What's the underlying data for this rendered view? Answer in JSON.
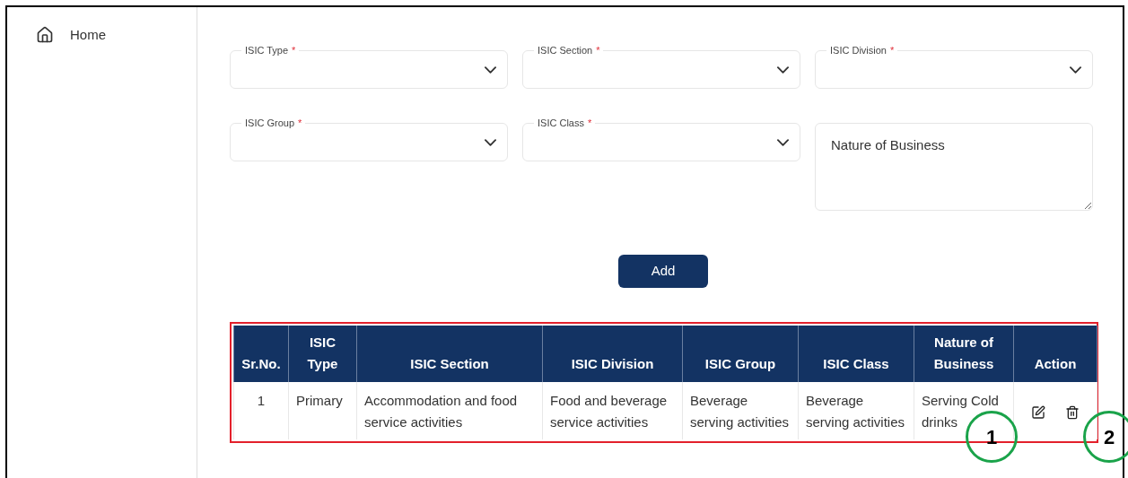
{
  "sidebar": {
    "items": [
      {
        "label": "Home",
        "selected": false
      }
    ]
  },
  "form": {
    "fields": [
      {
        "kind": "select",
        "label": "ISIC Type",
        "required_mark": "*"
      },
      {
        "kind": "select",
        "label": "ISIC Section",
        "required_mark": "*"
      },
      {
        "kind": "select",
        "label": "ISIC Division",
        "required_mark": "*"
      },
      {
        "kind": "select",
        "label": "ISIC Group",
        "required_mark": "*"
      },
      {
        "kind": "select",
        "label": "ISIC Class",
        "required_mark": "*"
      },
      {
        "kind": "textarea",
        "placeholder": "Nature of Business"
      }
    ],
    "add_button": "Add"
  },
  "table": {
    "columns": [
      "Sr.No.",
      "ISIC Type",
      "ISIC Section",
      "ISIC Division",
      "ISIC Group",
      "ISIC Class",
      "Nature of Business",
      "Action"
    ],
    "rows": [
      {
        "cells": [
          "1",
          "Primary",
          "Accommodation and food service activities",
          "Food and beverage service activities",
          "Beverage serving activities",
          "Beverage serving activities",
          "Serving Cold drinks"
        ],
        "actions": [
          {
            "kind": "edit"
          },
          {
            "kind": "delete"
          }
        ]
      }
    ]
  },
  "annotations": [
    {
      "kind": "box"
    },
    {
      "kind": "circle",
      "label": "1"
    },
    {
      "kind": "circle",
      "label": "2"
    }
  ]
}
